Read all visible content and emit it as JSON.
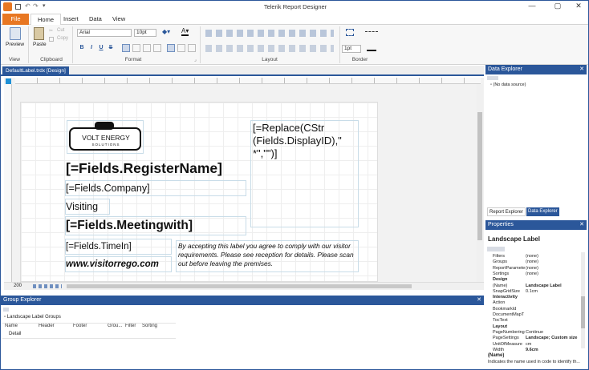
{
  "app": {
    "title": "Telerik Report Designer"
  },
  "ribbon": {
    "tabs": [
      "File",
      "Home",
      "Insert",
      "Data",
      "View"
    ],
    "preview_label": "Preview",
    "paste_label": "Paste",
    "cut_label": "Cut",
    "copy_label": "Copy",
    "font_name": "Arial",
    "font_size": "10pt",
    "border_width": "1pt",
    "groups": {
      "view": "View",
      "clipboard": "Clipboard",
      "format": "Format",
      "layout": "Layout",
      "border": "Border"
    },
    "bold": "B",
    "italic": "I",
    "underline": "U",
    "strike": "S"
  },
  "document": {
    "tab": "DefaultLabel.trdx [Design]",
    "zoom": "200"
  },
  "report": {
    "logo_text": "VOLT ENERGY",
    "logo_sub": "SOLUTIONS",
    "register_name": "[=Fields.RegisterName]",
    "company": "[=Fields.Company]",
    "visiting": "Visiting",
    "meeting": "[=Fields.Meetingwith]",
    "time_in": "[=Fields.TimeIn]",
    "website": "www.visitorrego.com",
    "disclaimer": "By accepting this label you agree to comply with our visitor requirements. Please see reception for details. Please scan out before leaving the premises.",
    "display_id_line1": "[=Replace(CStr",
    "display_id_line2": "(Fields.DisplayID),\"",
    "display_id_line3": "*\",\"\")]"
  },
  "data_explorer": {
    "title": "Data Explorer",
    "no_source": "(No data source)",
    "tabs": [
      "Report Explorer",
      "Data Explorer"
    ]
  },
  "properties": {
    "title": "Properties",
    "object": "Landscape Label",
    "rows": [
      {
        "name": "Filters",
        "value": "(none)",
        "cat": false
      },
      {
        "name": "Groups",
        "value": "(none)",
        "cat": false
      },
      {
        "name": "ReportParamete",
        "value": "(none)",
        "cat": false
      },
      {
        "name": "Sortings",
        "value": "(none)",
        "cat": false
      },
      {
        "name": "Design",
        "value": "",
        "cat": true
      },
      {
        "name": "(Name)",
        "value": "Landscape Label",
        "cat": false
      },
      {
        "name": "SnapGridSize",
        "value": "0.1cm",
        "cat": false
      },
      {
        "name": "Interactivity",
        "value": "",
        "cat": true
      },
      {
        "name": "Action",
        "value": "",
        "cat": false
      },
      {
        "name": "BookmarkId",
        "value": "",
        "cat": false
      },
      {
        "name": "DocumentMapT",
        "value": "",
        "cat": false
      },
      {
        "name": "TocText",
        "value": "",
        "cat": false
      },
      {
        "name": "Layout",
        "value": "",
        "cat": true
      },
      {
        "name": "PageNumbering",
        "value": "Continue",
        "cat": false
      },
      {
        "name": "PageSettings",
        "value": "Landscape; Custom size",
        "cat": false
      },
      {
        "name": "UnitOfMeasure",
        "value": "cm",
        "cat": false
      },
      {
        "name": "Width",
        "value": "9.6cm",
        "cat": false
      }
    ],
    "desc_title": "(Name)",
    "desc_text": "Indicates the name used in code to identify th..."
  },
  "group_explorer": {
    "title": "Group Explorer",
    "root": "Landscape Label Groups",
    "columns": [
      "Name",
      "Header",
      "Footer",
      "Grou...",
      "Filter",
      "Sorting"
    ],
    "row": "Detail"
  }
}
